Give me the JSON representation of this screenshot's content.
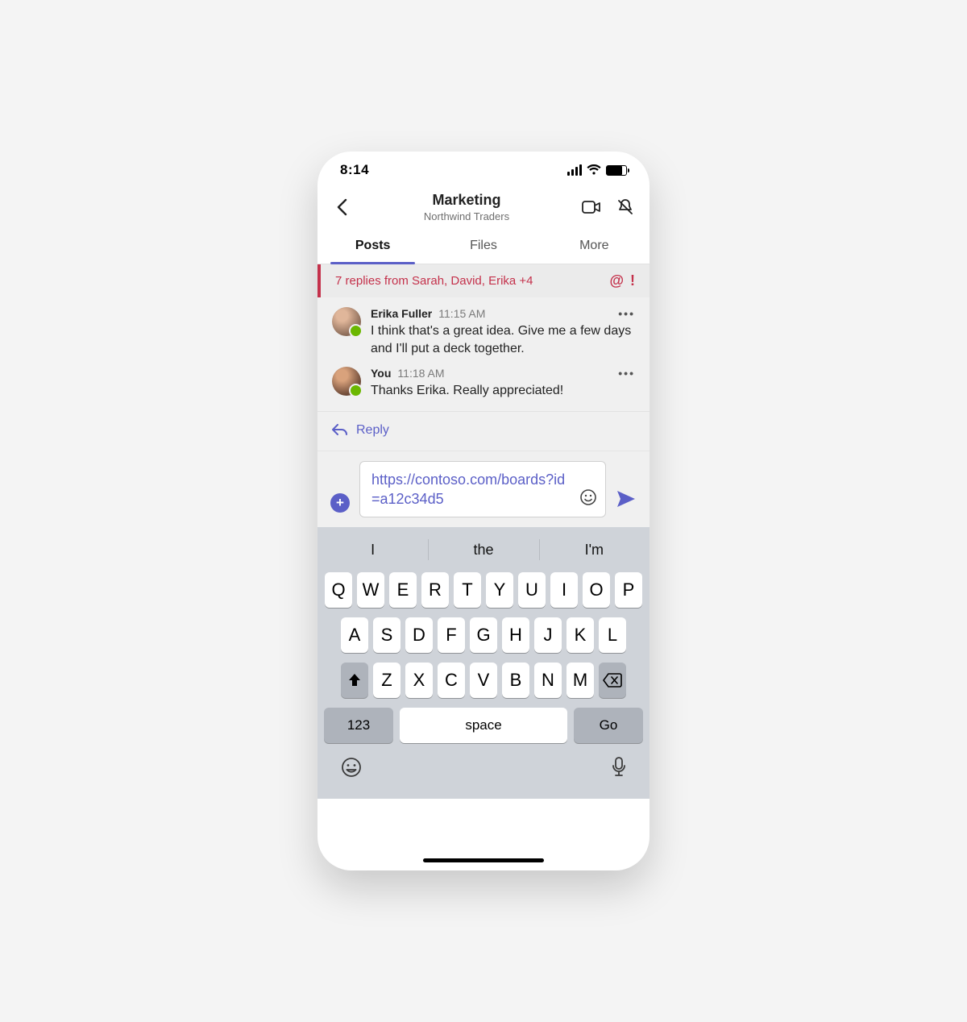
{
  "status": {
    "time": "8:14"
  },
  "header": {
    "title": "Marketing",
    "subtitle": "Northwind Traders"
  },
  "tabs": [
    "Posts",
    "Files",
    "More"
  ],
  "thread": {
    "summary": "7 replies from Sarah, David, Erika +4",
    "messages": [
      {
        "name": "Erika Fuller",
        "time": "11:15 AM",
        "text": "I think that's a great idea. Give me a few days and I'll put a deck together."
      },
      {
        "name": "You",
        "time": "11:18 AM",
        "text": "Thanks Erika. Really appreciated!"
      }
    ],
    "reply_label": "Reply"
  },
  "compose": {
    "text": "https://contoso.com/boards?id=a12c34d5"
  },
  "keyboard": {
    "suggestions": [
      "I",
      "the",
      "I'm"
    ],
    "row1": [
      "Q",
      "W",
      "E",
      "R",
      "T",
      "Y",
      "U",
      "I",
      "O",
      "P"
    ],
    "row2": [
      "A",
      "S",
      "D",
      "F",
      "G",
      "H",
      "J",
      "K",
      "L"
    ],
    "row3": [
      "Z",
      "X",
      "C",
      "V",
      "B",
      "N",
      "M"
    ],
    "num": "123",
    "space": "space",
    "go": "Go"
  }
}
